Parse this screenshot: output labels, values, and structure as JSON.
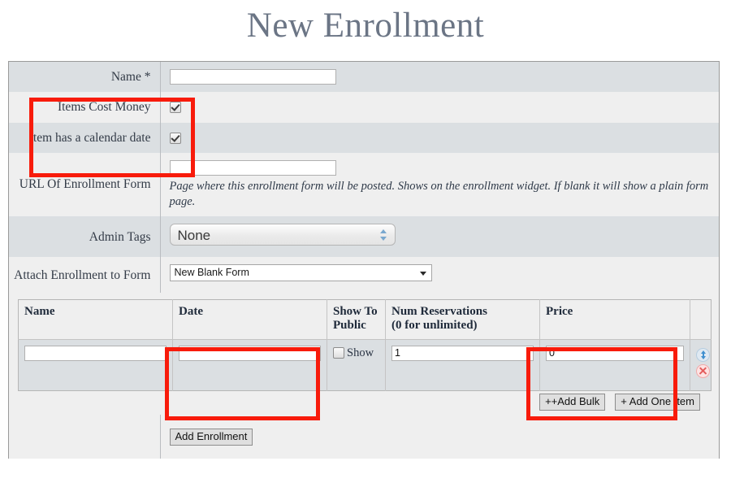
{
  "page": {
    "title": "New Enrollment"
  },
  "form": {
    "rows": [
      {
        "label": "Name *",
        "value": ""
      },
      {
        "label": "Items Cost Money",
        "checked": true
      },
      {
        "label": "Item has a calendar date",
        "checked": true
      },
      {
        "label": "URL Of Enrollment Form",
        "value": "",
        "helper": "Page where this enrollment form will be posted. Shows on the enrollment widget. If blank it will show a plain form page."
      },
      {
        "label": "Admin Tags",
        "value": "None"
      },
      {
        "label": "Attach Enrollment to Form",
        "value": "New Blank Form"
      }
    ],
    "name_label": "Name *",
    "items_cost_money_label": "Items Cost Money",
    "calendar_date_label": "Item has a calendar date",
    "url_label": "URL Of Enrollment Form",
    "url_value": "",
    "url_helper": "Page where this enrollment form will be posted. Shows on the enrollment widget. If blank it will show a plain form page.",
    "admin_tags_label": "Admin Tags",
    "admin_tags_value": "None",
    "attach_form_label": "Attach Enrollment to Form",
    "attach_form_value": "New Blank Form",
    "name_value": ""
  },
  "items_table": {
    "headers": [
      "Name",
      "Date",
      "Show To Public",
      "Num Reservations (0 for unlimited)",
      "Price",
      ""
    ],
    "header_name": "Name",
    "header_date": "Date",
    "header_show_line1": "Show To",
    "header_show_line2": "Public",
    "header_num_line1": "Num Reservations",
    "header_num_line2": "(0 for unlimited)",
    "header_price": "Price",
    "rows": [
      {
        "name": "",
        "date": "",
        "show_to_public": false,
        "show_label": "Show",
        "num_reservations": "1",
        "price": "0"
      }
    ]
  },
  "buttons": {
    "add_bulk": "++Add Bulk",
    "add_one_item": "+ Add One Item",
    "add_enrollment": "Add Enrollment"
  },
  "colors": {
    "title": "#6b7585",
    "row_dark": "#dbdfe2",
    "row_light": "#efefef",
    "annotation": "#f81b0b",
    "delete_icon": "#e45c5c",
    "move_icon": "#3f8fcf"
  }
}
